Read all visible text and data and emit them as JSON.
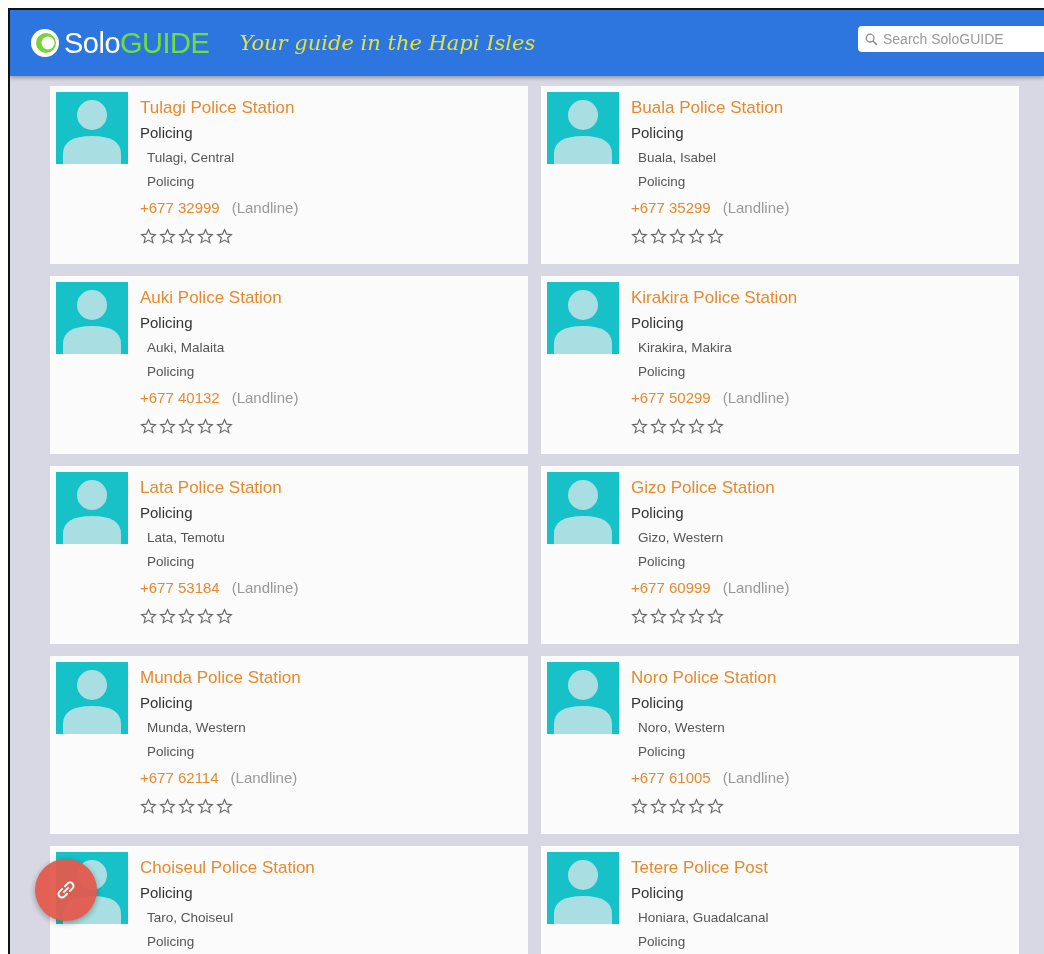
{
  "header": {
    "logo": [
      "Solo",
      "GUIDE"
    ],
    "tagline": "Your guide in the Hapi Isles",
    "search": {
      "placeholder": "Search SoloGUIDE"
    }
  },
  "listings": [
    {
      "title": "Tulagi Police Station",
      "category": "Policing",
      "location": "Tulagi, Central",
      "subcategory": "Policing",
      "phone": "+677 32999",
      "phone_type": "(Landline)",
      "stars": 0
    },
    {
      "title": "Buala Police Station",
      "category": "Policing",
      "location": "Buala, Isabel",
      "subcategory": "Policing",
      "phone": "+677 35299",
      "phone_type": "(Landline)",
      "stars": 0
    },
    {
      "title": "Auki Police Station",
      "category": "Policing",
      "location": "Auki, Malaita",
      "subcategory": "Policing",
      "phone": "+677 40132",
      "phone_type": "(Landline)",
      "stars": 0
    },
    {
      "title": "Kirakira Police Station",
      "category": "Policing",
      "location": "Kirakira, Makira",
      "subcategory": "Policing",
      "phone": "+677 50299",
      "phone_type": "(Landline)",
      "stars": 0
    },
    {
      "title": "Lata Police Station",
      "category": "Policing",
      "location": "Lata, Temotu",
      "subcategory": "Policing",
      "phone": "+677 53184",
      "phone_type": "(Landline)",
      "stars": 0
    },
    {
      "title": "Gizo Police Station",
      "category": "Policing",
      "location": "Gizo, Western",
      "subcategory": "Policing",
      "phone": "+677 60999",
      "phone_type": "(Landline)",
      "stars": 0
    },
    {
      "title": "Munda Police Station",
      "category": "Policing",
      "location": "Munda, Western",
      "subcategory": "Policing",
      "phone": "+677 62114",
      "phone_type": "(Landline)",
      "stars": 0
    },
    {
      "title": "Noro Police Station",
      "category": "Policing",
      "location": "Noro, Western",
      "subcategory": "Policing",
      "phone": "+677 61005",
      "phone_type": "(Landline)",
      "stars": 0
    },
    {
      "title": "Choiseul Police Station",
      "category": "Policing",
      "location": "Taro, Choiseul",
      "subcategory": "Policing"
    },
    {
      "title": "Tetere Police Post",
      "category": "Policing",
      "location": "Honiara, Guadalcanal",
      "subcategory": "Policing"
    }
  ]
}
